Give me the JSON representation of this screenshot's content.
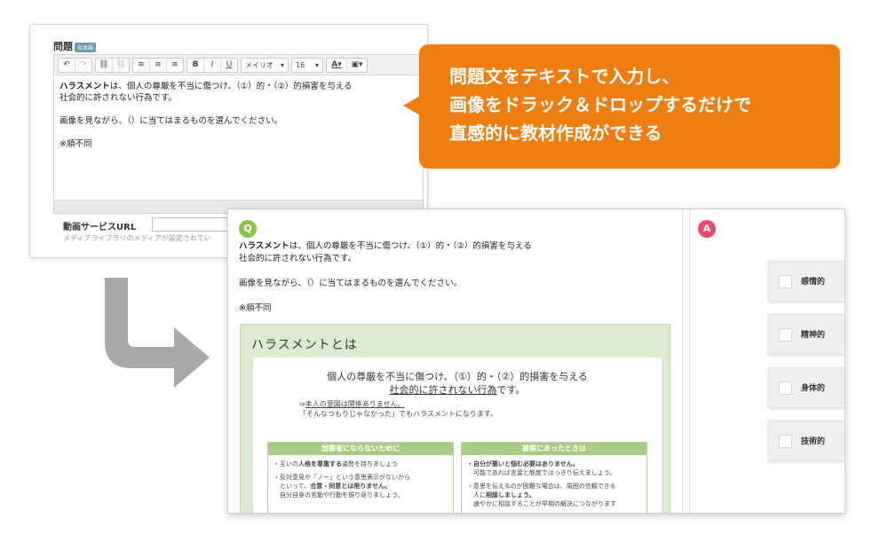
{
  "editor": {
    "label": "問題",
    "lang_badge": "日本語",
    "toolbar": {
      "font": "メイリオ",
      "size": "16"
    },
    "content": {
      "line1_bold": "ハラスメント",
      "line1_rest": "は、個人の尊厳を不当に傷つけ、（①）的・（②）的損害を与える",
      "line2": "社会的に許されない行為です。",
      "line3": "画像を見ながら、（）に当てはまるものを選んでください。",
      "line4": "※順不同"
    },
    "url_label": "動画サービスURL",
    "url_note": "メディアライブラリのメディアが設定されてい"
  },
  "callout": {
    "line1": "問題文をテキストで入力し、",
    "line2": "画像をドラック＆ドロップするだけで",
    "line3": "直感的に教材作成ができる"
  },
  "preview": {
    "q_badge": "Q",
    "a_badge": "A",
    "question": {
      "line1_bold": "ハラスメント",
      "line1_rest": "は、個人の尊厳を不当に傷つけ、（①）的・（②）的損害を与える",
      "line2": "社会的に許されない行為です。",
      "line3": "画像を見ながら、（）に当てはまるものを選んでください。",
      "line4": "※順不同"
    },
    "slide": {
      "title": "ハラスメントとは",
      "main_line1": "個人の尊厳を不当に傷つけ、（①）的・（②）的損害を与える",
      "main_line2_u": "社会的に許されない行為",
      "main_line2_rest": "です。",
      "note1_arrow": "⇒",
      "note1_u": "本人の意図は関係ありません。",
      "note2": "「そんなつもりじゃなかった」でもハラスメントになります。",
      "box_left": {
        "title": "加害者にならないために",
        "item1_pre": "・互いの",
        "item1_bold": "人格を尊重する",
        "item1_post": "姿勢を持ちましょう",
        "item2_a": "・反対意見や「ノー」という意思表示がないから",
        "item2_b_pre": "といって、",
        "item2_b_bold": "合意・同意とは限りません。",
        "item2_c": "自分自身の言動や行動を振り返りましょう。"
      },
      "box_right": {
        "title": "被害にあったときは",
        "item1_bold": "・自分が悪いと悩む必要はありません。",
        "item1_b": "可能であれば言葉と態度ではっきり伝えましょう。",
        "item2_a": "・意思を伝えるのが困難な場合は、周囲の信頼できる",
        "item2_b_pre": "人に",
        "item2_b_bold": "相談しましょう。",
        "item2_c": "速やかに相談することが早期の解決につながります"
      }
    },
    "choices": [
      "感情的",
      "精神的",
      "身体的",
      "技術的"
    ]
  }
}
